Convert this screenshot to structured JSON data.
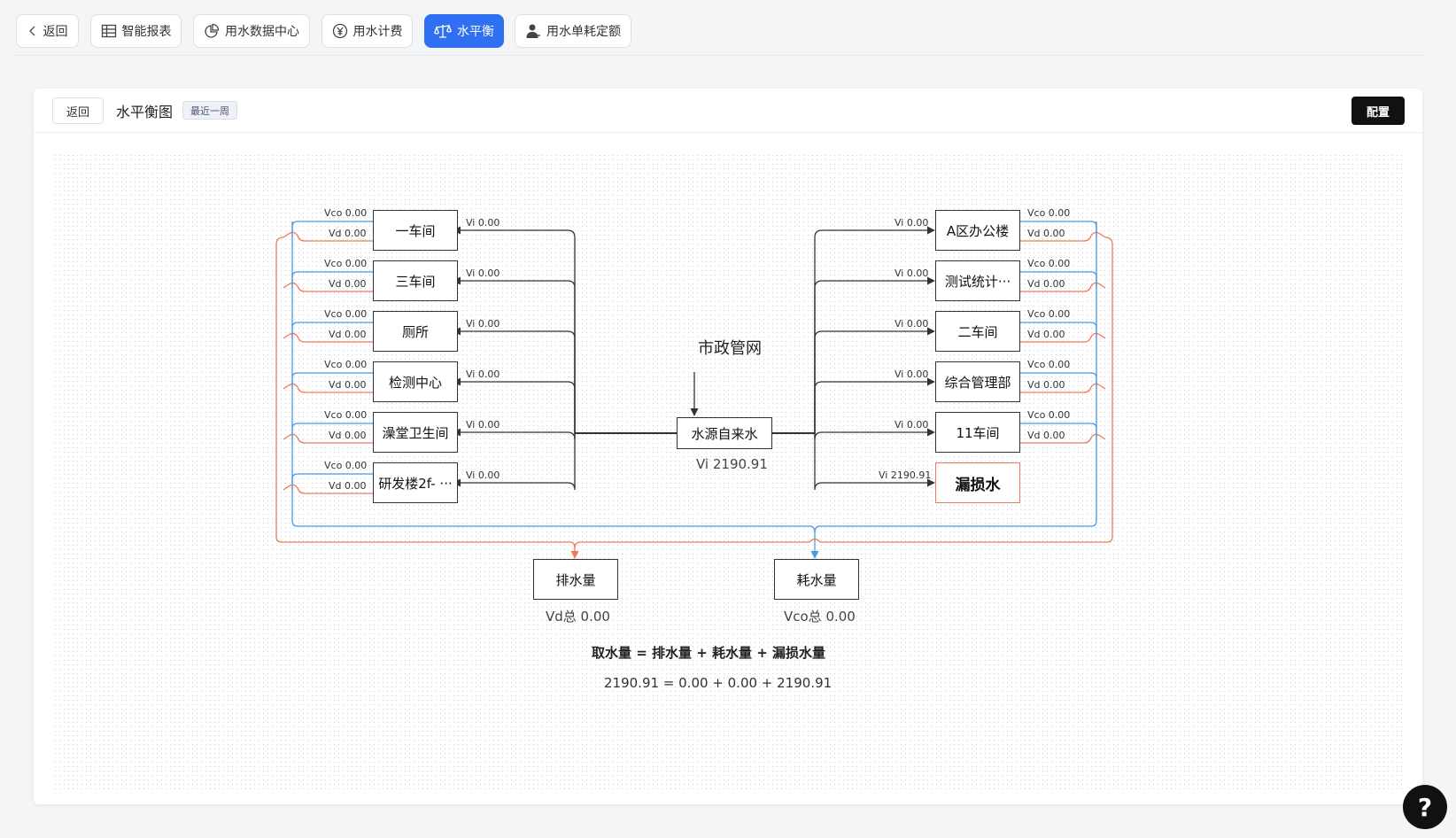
{
  "nav": {
    "back": "返回",
    "items": [
      {
        "label": "智能报表",
        "icon": "table-icon",
        "active": false
      },
      {
        "label": "用水数据中心",
        "icon": "pie-chart-icon",
        "active": false
      },
      {
        "label": "用水计费",
        "icon": "yen-icon",
        "active": false
      },
      {
        "label": "水平衡",
        "icon": "balance-scale-icon",
        "active": true
      },
      {
        "label": "用水单耗定额",
        "icon": "user-icon",
        "active": false
      }
    ]
  },
  "header": {
    "back": "返回",
    "title": "水平衡图",
    "range_tag": "最近一周",
    "config": "配置"
  },
  "diagram": {
    "source_title": "市政管网",
    "source_node": "水源自来水",
    "source_value": "Vi 2190.91",
    "left_units": [
      {
        "name": "一车间",
        "vi": "Vi 0.00",
        "vco": "Vco 0.00",
        "vd": "Vd 0.00"
      },
      {
        "name": "三车间",
        "vi": "Vi 0.00",
        "vco": "Vco 0.00",
        "vd": "Vd 0.00"
      },
      {
        "name": "厕所",
        "vi": "Vi 0.00",
        "vco": "Vco 0.00",
        "vd": "Vd 0.00"
      },
      {
        "name": "检测中心",
        "vi": "Vi 0.00",
        "vco": "Vco 0.00",
        "vd": "Vd 0.00"
      },
      {
        "name": "澡堂卫生间",
        "vi": "Vi 0.00",
        "vco": "Vco 0.00",
        "vd": "Vd 0.00"
      },
      {
        "name": "研发楼2f- ···",
        "vi": "Vi 0.00",
        "vco": "Vco 0.00",
        "vd": "Vd 0.00"
      }
    ],
    "right_units": [
      {
        "name": "A区办公楼",
        "vi": "Vi 0.00",
        "vco": "Vco 0.00",
        "vd": "Vd 0.00"
      },
      {
        "name": "测试统计···",
        "vi": "Vi 0.00",
        "vco": "Vco 0.00",
        "vd": "Vd 0.00"
      },
      {
        "name": "二车间",
        "vi": "Vi 0.00",
        "vco": "Vco 0.00",
        "vd": "Vd 0.00"
      },
      {
        "name": "综合管理部",
        "vi": "Vi 0.00",
        "vco": "Vco 0.00",
        "vd": "Vd 0.00"
      },
      {
        "name": "11车间",
        "vi": "Vi 0.00",
        "vco": "Vco 0.00",
        "vd": "Vd 0.00"
      }
    ],
    "leak": {
      "name": "漏损水",
      "vi": "Vi 2190.91"
    },
    "drain": {
      "name": "排水量",
      "total": "Vd总 0.00"
    },
    "consume": {
      "name": "耗水量",
      "total": "Vco总 0.00"
    },
    "formula": "取水量 = 排水量 + 耗水量 + 漏损水量",
    "formula_values": "2190.91 = 0.00 + 0.00 + 2190.91",
    "colors": {
      "vco": "#4a9ae0",
      "vd": "#f07a57",
      "line": "#333333",
      "accent": "#2f6ff1"
    }
  },
  "help": "?"
}
